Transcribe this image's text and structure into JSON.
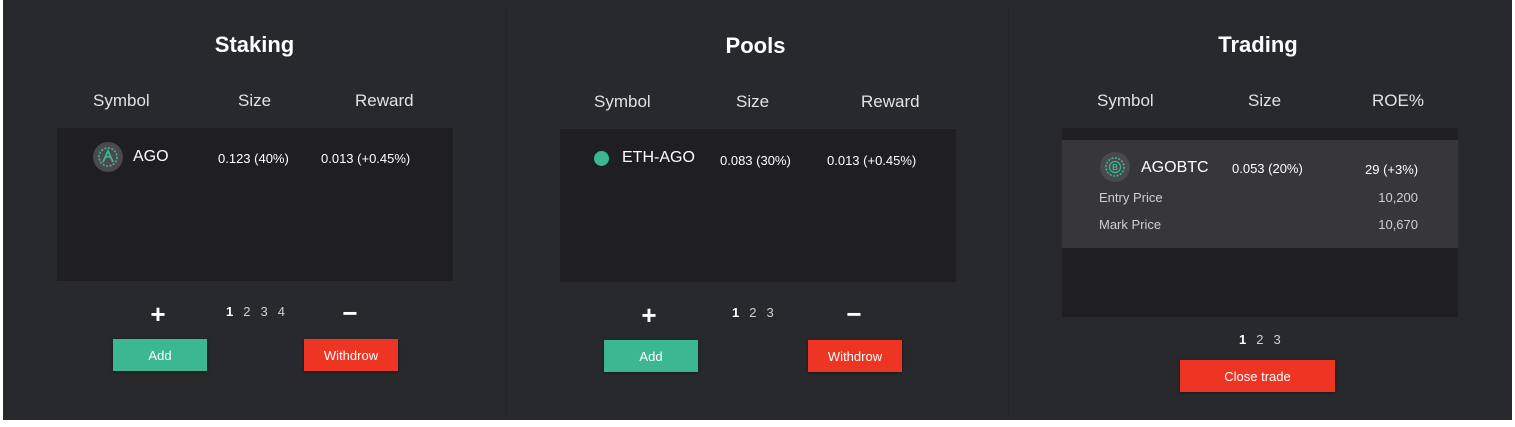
{
  "colors": {
    "background": "#28292d",
    "table": "#1f1f21",
    "highlight": "#37373a",
    "accent_green": "#3bb88f",
    "accent_red": "#ee3423"
  },
  "staking": {
    "title": "Staking",
    "headers": {
      "symbol": "Symbol",
      "size": "Size",
      "reward": "Reward"
    },
    "row": {
      "symbol": "AGO",
      "icon": "ago-coin-icon",
      "size": "0.123 (40%)",
      "reward": "0.013 (+0.45%)"
    },
    "plus": "+",
    "minus": "−",
    "pages": [
      "1",
      "2",
      "3",
      "4"
    ],
    "active_page": "1",
    "add_label": "Add",
    "withdraw_label": "Withdrow"
  },
  "pools": {
    "title": "Pools",
    "headers": {
      "symbol": "Symbol",
      "size": "Size",
      "reward": "Reward"
    },
    "row": {
      "symbol": "ETH-AGO",
      "icon": "green-dot-icon",
      "size": "0.083 (30%)",
      "reward": "0.013 (+0.45%)"
    },
    "plus": "+",
    "minus": "−",
    "pages": [
      "1",
      "2",
      "3"
    ],
    "active_page": "1",
    "add_label": "Add",
    "withdraw_label": "Withdrow"
  },
  "trading": {
    "title": "Trading",
    "headers": {
      "symbol": "Symbol",
      "size": "Size",
      "roe": "ROE%"
    },
    "row": {
      "symbol": "AGOBTC",
      "icon": "bitcoin-coin-icon",
      "size": "0.053 (20%)",
      "roe": "29 (+3%)",
      "entry_label": "Entry Price",
      "entry_value": "10,200",
      "mark_label": "Mark Price",
      "mark_value": "10,670"
    },
    "pages": [
      "1",
      "2",
      "3"
    ],
    "active_page": "1",
    "close_label": "Close trade"
  }
}
